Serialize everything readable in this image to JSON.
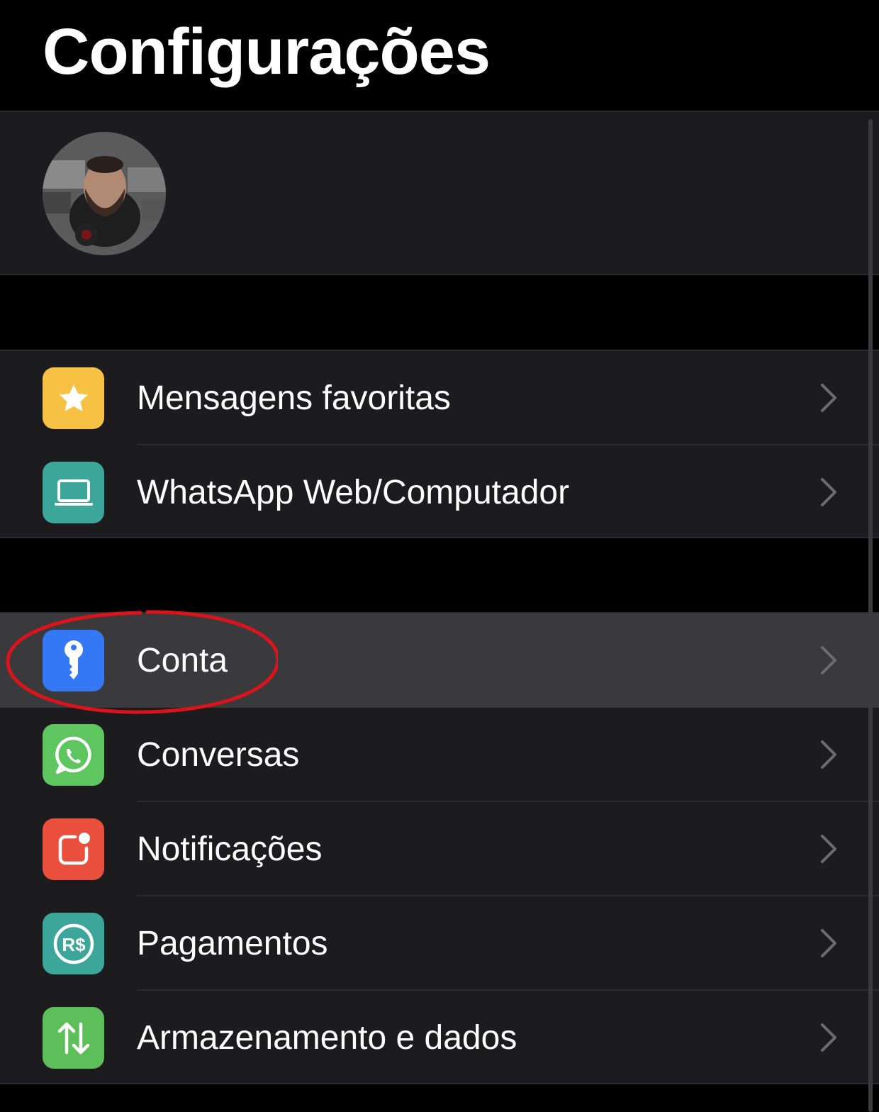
{
  "header": {
    "title": "Configurações"
  },
  "profile": {
    "avatar_icon": "user-avatar-photo"
  },
  "group1": {
    "items": [
      {
        "label": "Mensagens favoritas",
        "icon": "star-icon",
        "color": "#f7c244"
      },
      {
        "label": "WhatsApp Web/Computador",
        "icon": "laptop-icon",
        "color": "#3ca69b"
      }
    ]
  },
  "group2": {
    "items": [
      {
        "label": "Conta",
        "icon": "key-icon",
        "color": "#3478f6",
        "highlighted": true
      },
      {
        "label": "Conversas",
        "icon": "whatsapp-icon",
        "color": "#5fc65f"
      },
      {
        "label": "Notificações",
        "icon": "notification-badge-icon",
        "color": "#ea4f3e"
      },
      {
        "label": "Pagamentos",
        "icon": "real-currency-icon",
        "color": "#3ca69b"
      },
      {
        "label": "Armazenamento e dados",
        "icon": "up-down-arrows-icon",
        "color": "#5cbf5a"
      }
    ]
  },
  "colors": {
    "background": "#000000",
    "cell": "#1c1c1e",
    "highlight": "#3a3a3c",
    "annotation": "#d9141c"
  }
}
